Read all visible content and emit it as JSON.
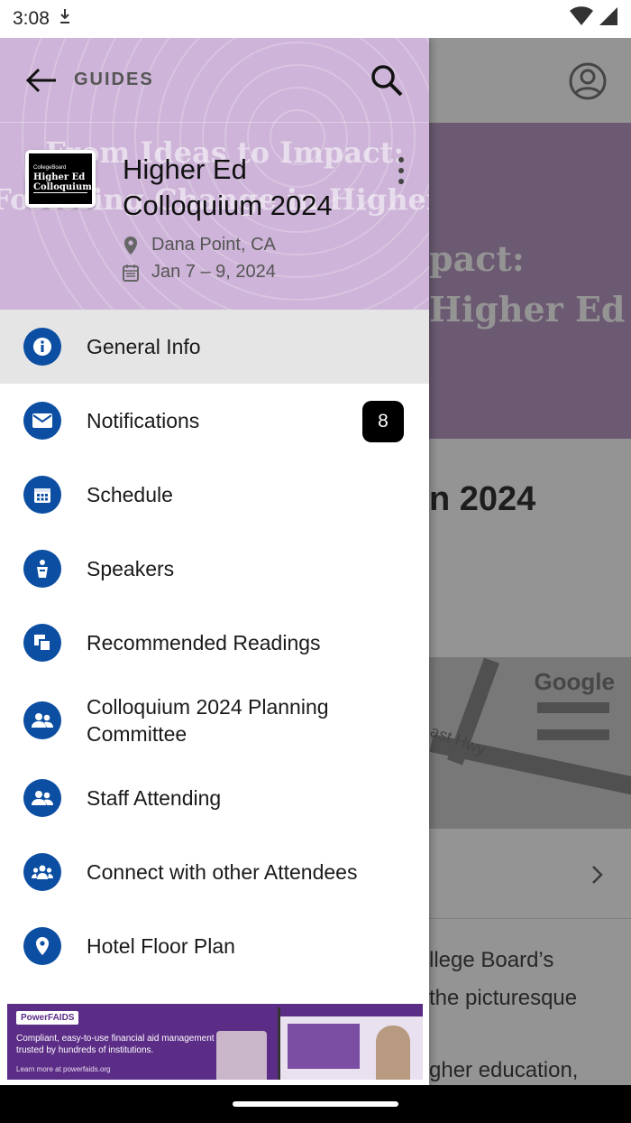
{
  "status_bar": {
    "time": "3:08"
  },
  "background": {
    "hero_line1": "pact:",
    "hero_line2": "Higher Ed",
    "title_fragment": "n 2024",
    "map_google": "Google",
    "map_road_label": "ast Hwy",
    "text_line1": "llege Board’s",
    "text_line2": "the picturesque",
    "text_line3": "gher education,"
  },
  "drawer": {
    "header": {
      "section_label": "GUIDES",
      "hero_text_line1": "From Ideas to Impact:",
      "hero_text_line2": "Fostering Change in Higher Ed"
    },
    "event": {
      "logo_brand": "CollegeBoard",
      "logo_line1": "Higher Ed",
      "logo_line2": "Colloquium",
      "title": "Higher Ed Colloquium 2024",
      "location": "Dana Point, CA",
      "dates": "Jan 7 – 9, 2024"
    },
    "menu": [
      {
        "label": "General Info",
        "icon": "info-icon",
        "active": true
      },
      {
        "label": "Notifications",
        "icon": "envelope-icon",
        "badge": "8"
      },
      {
        "label": "Schedule",
        "icon": "calendar-icon"
      },
      {
        "label": "Speakers",
        "icon": "podium-icon"
      },
      {
        "label": "Recommended Readings",
        "icon": "copy-icon"
      },
      {
        "label": "Colloquium 2024 Planning Committee",
        "icon": "people-icon"
      },
      {
        "label": "Staff Attending",
        "icon": "people-icon"
      },
      {
        "label": "Connect with other Attendees",
        "icon": "group-icon"
      },
      {
        "label": "Hotel Floor Plan",
        "icon": "map-pin-icon"
      }
    ],
    "banner": {
      "brand": "PowerFAIDS",
      "tagline": "Compliant, easy-to-use financial aid management trusted by hundreds of institutions.",
      "cta": "Learn more at powerfaids.org"
    }
  },
  "colors": {
    "accent": "#0b4ea2",
    "hero": "#cdb4d8",
    "badge": "#000000"
  }
}
